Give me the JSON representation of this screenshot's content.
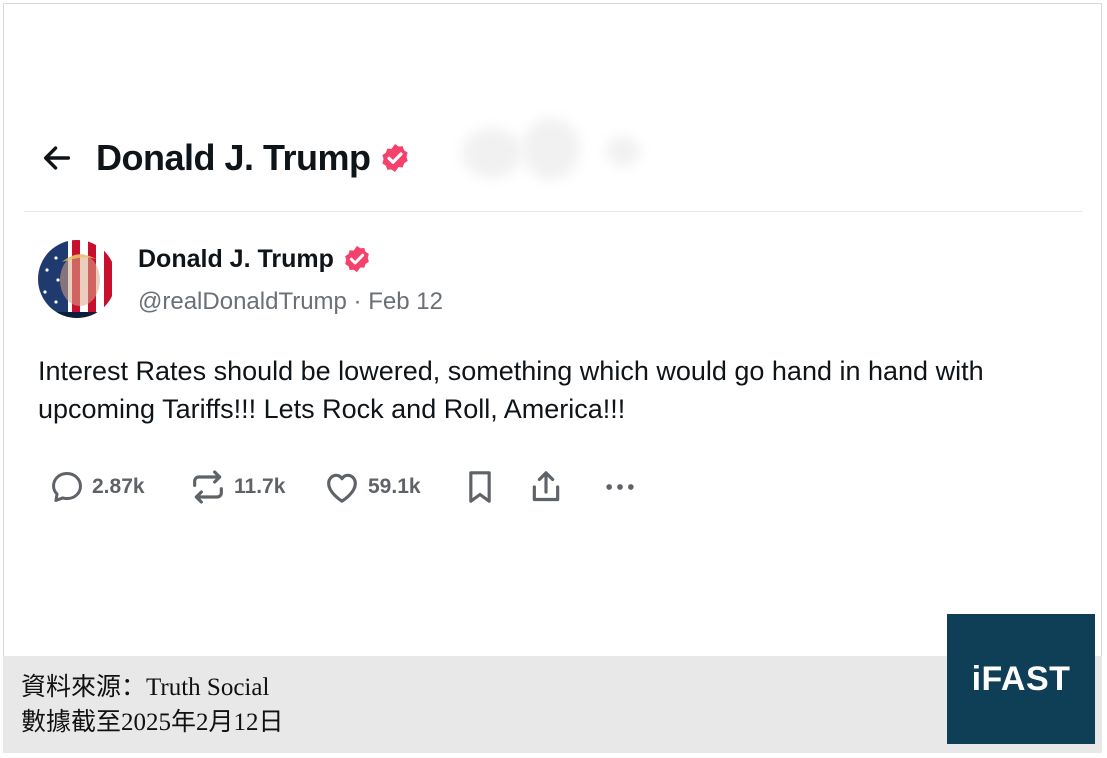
{
  "header": {
    "title": "Donald J. Trump",
    "back_icon": "arrow-left-icon",
    "verified_icon": "verified-badge-icon"
  },
  "post": {
    "author_name": "Donald J. Trump",
    "handle_date": "@realDonaldTrump · Feb 12",
    "text": "Interest Rates should be lowered, something which would go hand in hand with upcoming Tariffs!!! Lets Rock and Roll, America!!!",
    "actions": {
      "replies": "2.87k",
      "reposts": "11.7k",
      "likes": "59.1k"
    }
  },
  "footer": {
    "source": "資料來源：Truth Social",
    "date_note": "數據截至2025年2月12日",
    "logo": "iFAST"
  },
  "colors": {
    "verified": "#f5426c",
    "text": "#0f1419",
    "muted": "#6b6f76",
    "logo_bg": "#0f3f56",
    "footer_bg": "#e8e8e8"
  }
}
